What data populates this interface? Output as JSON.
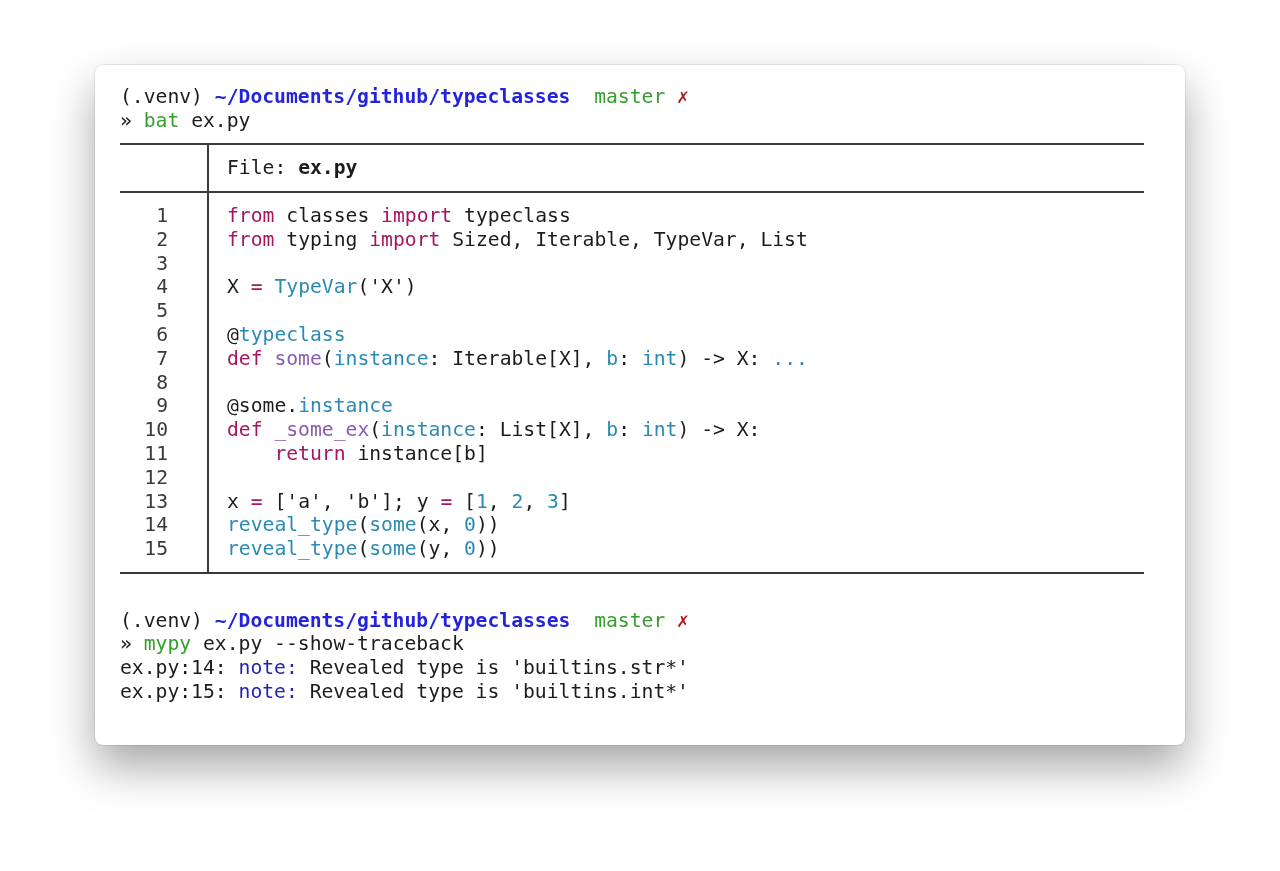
{
  "session": [
    {
      "kind": "prompt",
      "segments": [
        {
          "text": "(.venv) ",
          "kind": "plain"
        },
        {
          "text": "~/Documents/github/typeclasses",
          "kind": "path"
        },
        {
          "text": "  master",
          "kind": "branch"
        },
        {
          "text": " ✗",
          "kind": "dirty"
        }
      ]
    },
    {
      "kind": "command",
      "segments": [
        {
          "text": "» ",
          "kind": "plain"
        },
        {
          "text": "bat",
          "kind": "program"
        },
        {
          "text": " ex.py",
          "kind": "plain"
        }
      ]
    },
    {
      "kind": "bat",
      "file_label": "File: ",
      "file_name": "ex.py",
      "lines": [
        {
          "number": "1",
          "segments": [
            {
              "text": "from",
              "kind": "keyword"
            },
            {
              "text": " classes ",
              "kind": "plain"
            },
            {
              "text": "import",
              "kind": "keyword"
            },
            {
              "text": " typeclass",
              "kind": "plain"
            }
          ]
        },
        {
          "number": "2",
          "segments": [
            {
              "text": "from",
              "kind": "keyword"
            },
            {
              "text": " typing ",
              "kind": "plain"
            },
            {
              "text": "import",
              "kind": "keyword"
            },
            {
              "text": " Sized, Iterable, TypeVar, List",
              "kind": "plain"
            }
          ]
        },
        {
          "number": "3"
        },
        {
          "number": "4",
          "segments": [
            {
              "text": "X ",
              "kind": "plain"
            },
            {
              "text": "=",
              "kind": "keyword"
            },
            {
              "text": " TypeVar",
              "kind": "builtin"
            },
            {
              "text": "('X')",
              "kind": "plain"
            }
          ]
        },
        {
          "number": "5"
        },
        {
          "number": "6",
          "segments": [
            {
              "text": "@",
              "kind": "plain"
            },
            {
              "text": "typeclass",
              "kind": "builtin"
            }
          ]
        },
        {
          "number": "7",
          "segments": [
            {
              "text": "def",
              "kind": "keyword"
            },
            {
              "text": " some",
              "kind": "function"
            },
            {
              "text": "(",
              "kind": "plain"
            },
            {
              "text": "instance",
              "kind": "builtin"
            },
            {
              "text": ": Iterable[X], ",
              "kind": "plain"
            },
            {
              "text": "b",
              "kind": "builtin"
            },
            {
              "text": ": ",
              "kind": "plain"
            },
            {
              "text": "int",
              "kind": "builtin"
            },
            {
              "text": ") -> X: ",
              "kind": "plain"
            },
            {
              "text": "...",
              "kind": "builtin"
            }
          ]
        },
        {
          "number": "8"
        },
        {
          "number": "9",
          "segments": [
            {
              "text": "@some.",
              "kind": "plain"
            },
            {
              "text": "instance",
              "kind": "builtin"
            }
          ]
        },
        {
          "number": "10",
          "segments": [
            {
              "text": "def",
              "kind": "keyword"
            },
            {
              "text": " _some_ex",
              "kind": "function"
            },
            {
              "text": "(",
              "kind": "plain"
            },
            {
              "text": "instance",
              "kind": "builtin"
            },
            {
              "text": ": List[X], ",
              "kind": "plain"
            },
            {
              "text": "b",
              "kind": "builtin"
            },
            {
              "text": ": ",
              "kind": "plain"
            },
            {
              "text": "int",
              "kind": "builtin"
            },
            {
              "text": ") -> X:",
              "kind": "plain"
            }
          ]
        },
        {
          "number": "11",
          "segments": [
            {
              "text": "    return",
              "kind": "keyword"
            },
            {
              "text": " instance[b]",
              "kind": "plain"
            }
          ]
        },
        {
          "number": "12"
        },
        {
          "number": "13",
          "segments": [
            {
              "text": "x ",
              "kind": "plain"
            },
            {
              "text": "=",
              "kind": "keyword"
            },
            {
              "text": " ['a', 'b']; y ",
              "kind": "plain"
            },
            {
              "text": "=",
              "kind": "keyword"
            },
            {
              "text": " [",
              "kind": "plain"
            },
            {
              "text": "1",
              "kind": "builtin"
            },
            {
              "text": ", ",
              "kind": "plain"
            },
            {
              "text": "2",
              "kind": "builtin"
            },
            {
              "text": ", ",
              "kind": "plain"
            },
            {
              "text": "3",
              "kind": "builtin"
            },
            {
              "text": "]",
              "kind": "plain"
            }
          ]
        },
        {
          "number": "14",
          "segments": [
            {
              "text": "reveal_type",
              "kind": "builtin"
            },
            {
              "text": "(",
              "kind": "plain"
            },
            {
              "text": "some",
              "kind": "builtin"
            },
            {
              "text": "(x, ",
              "kind": "plain"
            },
            {
              "text": "0",
              "kind": "builtin"
            },
            {
              "text": "))",
              "kind": "plain"
            }
          ]
        },
        {
          "number": "15",
          "segments": [
            {
              "text": "reveal_type",
              "kind": "builtin"
            },
            {
              "text": "(",
              "kind": "plain"
            },
            {
              "text": "some",
              "kind": "builtin"
            },
            {
              "text": "(y, ",
              "kind": "plain"
            },
            {
              "text": "0",
              "kind": "builtin"
            },
            {
              "text": "))",
              "kind": "plain"
            }
          ]
        }
      ]
    },
    {
      "kind": "prompt",
      "segments": [
        {
          "text": "(.venv) ",
          "kind": "plain"
        },
        {
          "text": "~/Documents/github/typeclasses",
          "kind": "path"
        },
        {
          "text": "  master",
          "kind": "branch"
        },
        {
          "text": " ✗",
          "kind": "dirty"
        }
      ]
    },
    {
      "kind": "command",
      "segments": [
        {
          "text": "» ",
          "kind": "plain"
        },
        {
          "text": "mypy",
          "kind": "program"
        },
        {
          "text": " ex.py --show-traceback",
          "kind": "plain"
        }
      ]
    },
    {
      "kind": "output",
      "segments": [
        {
          "text": "ex.py:14: ",
          "kind": "plain"
        },
        {
          "text": "note:",
          "kind": "note"
        },
        {
          "text": " Revealed type is 'builtins.str*'",
          "kind": "plain"
        }
      ]
    },
    {
      "kind": "output",
      "segments": [
        {
          "text": "ex.py:15: ",
          "kind": "plain"
        },
        {
          "text": "note:",
          "kind": "note"
        },
        {
          "text": " Revealed type is 'builtins.int*'",
          "kind": "plain"
        }
      ]
    }
  ]
}
